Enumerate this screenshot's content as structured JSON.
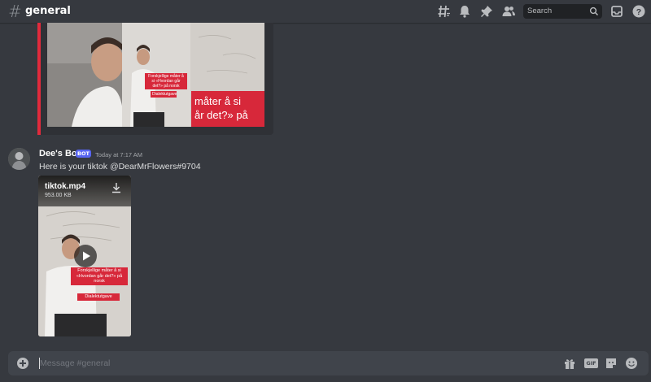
{
  "header": {
    "channel_name": "general",
    "search_placeholder": "Search",
    "icons": [
      "threads-icon",
      "bell-icon",
      "pin-icon",
      "members-icon",
      "search-icon",
      "inbox-icon",
      "help-icon"
    ]
  },
  "embed": {
    "accent_color": "#e22a3c",
    "big_caption_line1": "måter å si",
    "big_caption_line2": "år det?» på",
    "small_caption_1": "Forskjellige måter å si «Hvordan går det?» på norsk",
    "small_caption_2": "Dialektutgave"
  },
  "message": {
    "username": "Dee's Bot",
    "bot_tag": "BOT",
    "timestamp": "Today at 7:17 AM",
    "text": "Here is your tiktok @DearMrFlowers#9704",
    "attachment": {
      "file_name": "tiktok.mp4",
      "file_size": "953.00 KB",
      "caption_1": "Forskjellige måter å si «Hvordan går det?» på norsk",
      "caption_2": "Dialektutgave"
    }
  },
  "composer": {
    "placeholder": "Message #general",
    "gif_label": "GIF"
  }
}
